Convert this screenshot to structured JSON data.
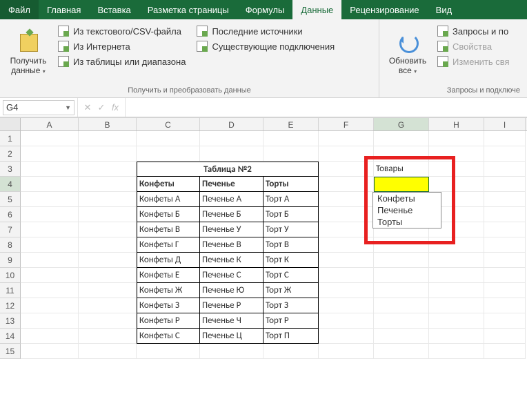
{
  "tabs": {
    "file": "Файл",
    "home": "Главная",
    "insert": "Вставка",
    "layout": "Разметка страницы",
    "formulas": "Формулы",
    "data": "Данные",
    "review": "Рецензирование",
    "view": "Вид"
  },
  "ribbon": {
    "group1": {
      "get_data": "Получить\nданные",
      "from_csv": "Из текстового/CSV-файла",
      "from_web": "Из Интернета",
      "from_table": "Из таблицы или диапазона",
      "recent": "Последние источники",
      "existing": "Существующие подключения",
      "label": "Получить и преобразовать данные"
    },
    "group2": {
      "refresh": "Обновить\nвсе",
      "queries": "Запросы и по",
      "properties": "Свойства",
      "edit_links": "Изменить свя",
      "label": "Запросы и подключе"
    }
  },
  "namebox": "G4",
  "formula": "",
  "columns": [
    "A",
    "B",
    "C",
    "D",
    "E",
    "F",
    "G",
    "H",
    "I"
  ],
  "row_count": 15,
  "selected": {
    "col": "G",
    "row": 4
  },
  "table": {
    "title": "Таблица №2",
    "headers": [
      "Конфеты",
      "Печенье",
      "Торты"
    ],
    "rows": [
      [
        "Конфеты А",
        "Печенье А",
        "Торт А"
      ],
      [
        "Конфеты Б",
        "Печенье Б",
        "Торт Б"
      ],
      [
        "Конфеты В",
        "Печенье У",
        "Торт У"
      ],
      [
        "Конфеты Г",
        "Печенье В",
        "Торт В"
      ],
      [
        "Конфеты Д",
        "Печенье К",
        "Торт К"
      ],
      [
        "Конфеты Е",
        "Печенье С",
        "Торт С"
      ],
      [
        "Конфеты Ж",
        "Печенье Ю",
        "Торт Ж"
      ],
      [
        "Конфеты З",
        "Печенье Р",
        "Торт З"
      ],
      [
        "Конфеты Р",
        "Печенье Ч",
        "Торт Р"
      ],
      [
        "Конфеты С",
        "Печенье Ц",
        "Торт П"
      ]
    ]
  },
  "side": {
    "label": "Товары",
    "value": "",
    "options": [
      "Конфеты",
      "Печенье",
      "Торты"
    ]
  }
}
